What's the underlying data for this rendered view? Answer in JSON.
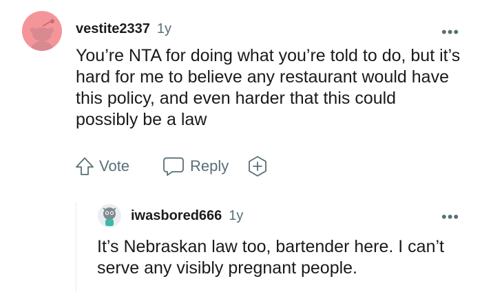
{
  "comment": {
    "username": "vestite2337",
    "age": "1y",
    "more": "•••",
    "body": "You’re NTA for doing what you’re told to do, but it’s hard for me to believe any restaurant would have this policy, and even harder that this could possibly be a law",
    "actions": {
      "vote_label": "Vote",
      "reply_label": "Reply"
    },
    "avatar_color": "#f4959a"
  },
  "reply": {
    "username": "iwasbored666",
    "age": "1y",
    "more": "•••",
    "body": "It’s Nebraskan law too, bartender here. I can’t serve any visibly pregnant people."
  },
  "colors": {
    "meta_gray": "#576f76",
    "text": "#1a1a1b",
    "thread_line": "#e5ebee"
  },
  "icons": [
    "upvote-icon",
    "comment-bubble-icon",
    "award-plus-icon",
    "more-options-icon"
  ]
}
